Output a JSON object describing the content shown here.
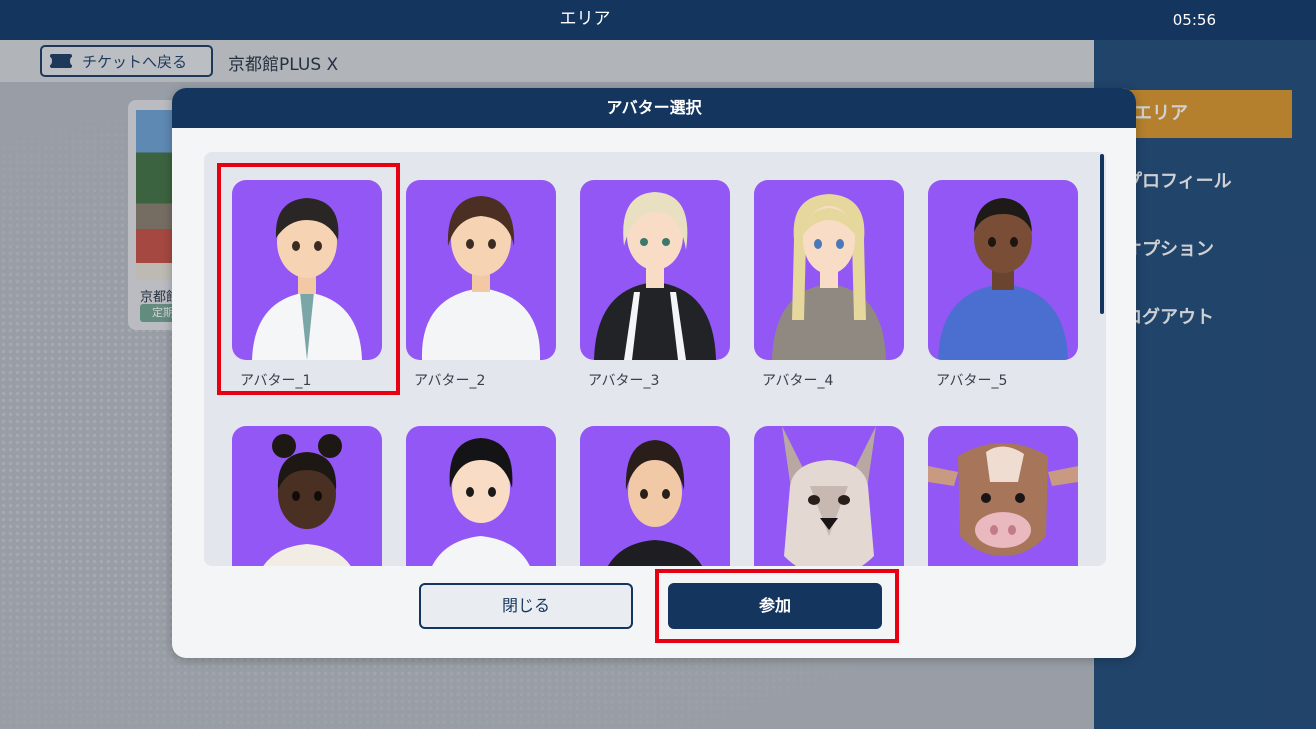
{
  "header": {
    "title": "エリア",
    "clock": "05:56"
  },
  "breadcrumb": {
    "back_label": "チケットへ戻る",
    "area_title": "京都館PLUS X"
  },
  "area_card": {
    "name": "京都館",
    "tag": "定期"
  },
  "sidemenu": {
    "items": [
      {
        "label": "エリア",
        "active": true
      },
      {
        "label": "プロフィール",
        "active": false
      },
      {
        "label": "オプション",
        "active": false
      },
      {
        "label": "ログアウト",
        "active": false
      }
    ],
    "active_color": "#dd9522",
    "background": "#194474"
  },
  "modal": {
    "title": "アバター選択",
    "avatars": [
      {
        "label": "アバター_1",
        "selected": true
      },
      {
        "label": "アバター_2"
      },
      {
        "label": "アバター_3"
      },
      {
        "label": "アバター_4"
      },
      {
        "label": "アバター_5"
      },
      {
        "label": ""
      },
      {
        "label": ""
      },
      {
        "label": ""
      },
      {
        "label": ""
      },
      {
        "label": ""
      }
    ],
    "close_label": "閉じる",
    "join_label": "参加"
  },
  "colors": {
    "navy": "#14355e",
    "avatar_bg": "#9257f5",
    "highlight": "#e60012"
  }
}
